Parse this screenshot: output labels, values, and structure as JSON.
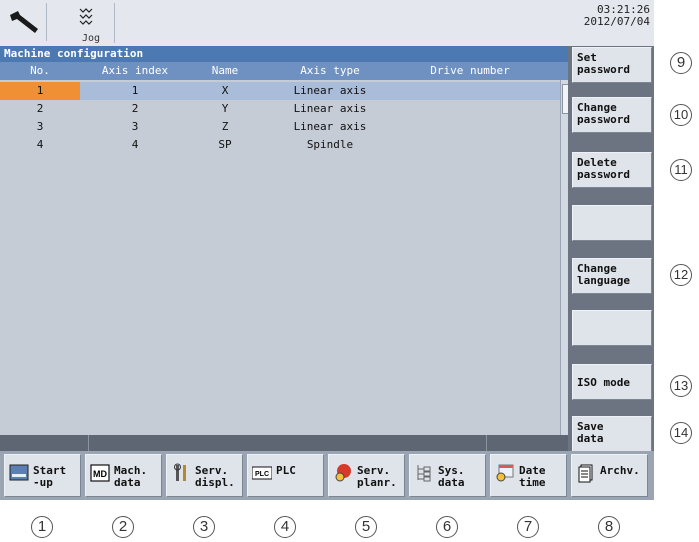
{
  "header": {
    "mode_label": "Jog",
    "time": "03:21:26",
    "date": "2012/07/04"
  },
  "panel": {
    "title": "Machine configuration",
    "columns": [
      "No.",
      "Axis index",
      "Name",
      "Axis type",
      "Drive number"
    ],
    "rows": [
      {
        "no": "1",
        "axis_index": "1",
        "name": "X",
        "axis_type": "Linear axis",
        "drive_number": ""
      },
      {
        "no": "2",
        "axis_index": "2",
        "name": "Y",
        "axis_type": "Linear axis",
        "drive_number": ""
      },
      {
        "no": "3",
        "axis_index": "3",
        "name": "Z",
        "axis_type": "Linear axis",
        "drive_number": ""
      },
      {
        "no": "4",
        "axis_index": "4",
        "name": "SP",
        "axis_type": "Spindle",
        "drive_number": ""
      }
    ]
  },
  "vertical_softkeys": [
    {
      "label": "Set\npassword"
    },
    {
      "label": "Change\npassword"
    },
    {
      "label": "Delete\npassword"
    },
    {
      "label": ""
    },
    {
      "label": "Change\nlanguage"
    },
    {
      "label": ""
    },
    {
      "label": "ISO mode"
    },
    {
      "label": "Save\ndata"
    }
  ],
  "horizontal_softkeys": [
    {
      "label": "Start\n-up",
      "icon": "startup-icon"
    },
    {
      "label": "Mach.\ndata",
      "icon": "md-icon"
    },
    {
      "label": "Serv.\ndispl.",
      "icon": "tools-icon"
    },
    {
      "label": "PLC",
      "icon": "plc-icon"
    },
    {
      "label": "Serv.\nplanr.",
      "icon": "service-planner-icon"
    },
    {
      "label": "Sys.\ndata",
      "icon": "system-data-icon"
    },
    {
      "label": "Date\ntime",
      "icon": "date-time-icon"
    },
    {
      "label": "Archv.",
      "icon": "archive-icon"
    }
  ],
  "callouts": {
    "bottom": [
      "1",
      "2",
      "3",
      "4",
      "5",
      "6",
      "7",
      "8"
    ],
    "right": [
      "9",
      "10",
      "11",
      "12",
      "13",
      "14"
    ]
  },
  "colors": {
    "title_bar": "#4d79b3",
    "header_row": "#6f91c2",
    "selected_row": "#a9bcd9",
    "focus_cell": "#ef9035",
    "background": "#c5ccd6"
  }
}
